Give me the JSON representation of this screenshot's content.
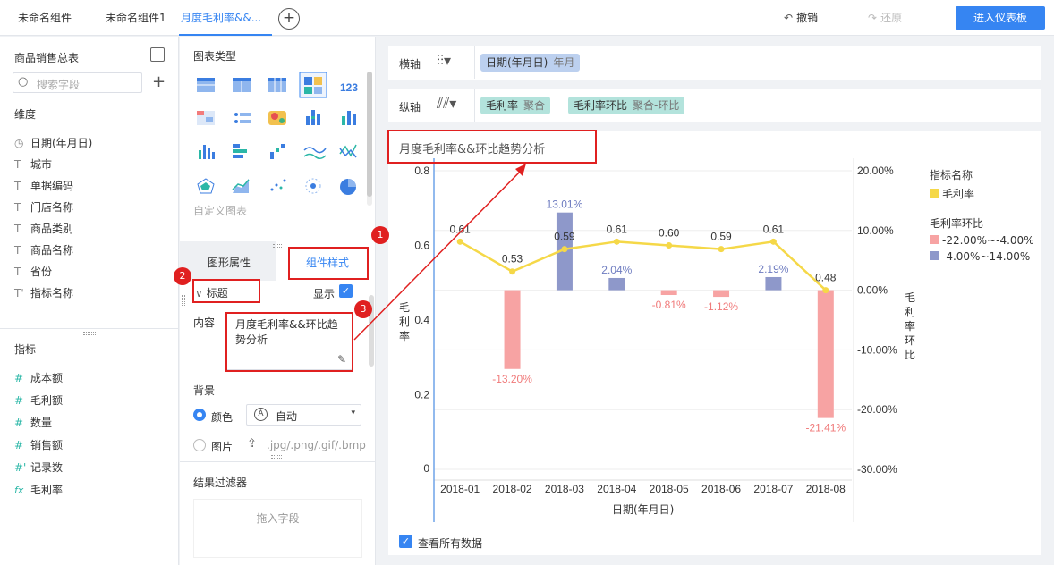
{
  "tabs": [
    {
      "label": "未命名组件"
    },
    {
      "label": "未命名组件1"
    },
    {
      "label": "月度毛利率&&..."
    }
  ],
  "toolbar": {
    "undo": "撤销",
    "redo": "还原",
    "enter_dashboard": "进入仪表板"
  },
  "left": {
    "table_title": "商品销售总表",
    "search_placeholder": "搜索字段",
    "dimensions_title": "维度",
    "dimensions": [
      "日期(年月日)",
      "城市",
      "单据编码",
      "门店名称",
      "商品类别",
      "商品名称",
      "省份",
      "指标名称"
    ],
    "metrics_title": "指标",
    "metrics": [
      "成本额",
      "毛利额",
      "数量",
      "销售额",
      "记录数",
      "毛利率"
    ]
  },
  "middle": {
    "chart_type_title": "图表类型",
    "custom_chart": "自定义图表",
    "tab_shape": "图形属性",
    "tab_style": "组件样式",
    "title_section": "标题",
    "show_label": "显示",
    "content_label": "内容",
    "content_text": "月度毛利率&&环比趋势分析",
    "background_label": "背景",
    "color_option": "颜色",
    "auto_option": "自动",
    "image_option": "图片",
    "image_formats": ".jpg/.png/.gif/.bmp",
    "filter_title": "结果过滤器",
    "drop_field": "拖入字段"
  },
  "axes": {
    "x_label": "横轴",
    "y_label": "纵轴",
    "x_pill": {
      "name": "日期(年月日)",
      "sub": "年月"
    },
    "y_pills": [
      {
        "name": "毛利率",
        "sub": "聚合"
      },
      {
        "name": "毛利率环比",
        "sub": "聚合-环比"
      }
    ]
  },
  "chart_data": {
    "type": "bar",
    "title": "月度毛利率&&环比趋势分析",
    "categories": [
      "2018-01",
      "2018-02",
      "2018-03",
      "2018-04",
      "2018-05",
      "2018-06",
      "2018-07",
      "2018-08"
    ],
    "line": {
      "name": "毛利率",
      "values": [
        0.61,
        0.53,
        0.59,
        0.61,
        0.6,
        0.59,
        0.61,
        0.48
      ],
      "labels": [
        "0.61",
        "0.53",
        "0.59",
        "0.61",
        "0.60",
        "0.59",
        "0.61",
        "0.48"
      ]
    },
    "bars": {
      "name": "毛利率环比",
      "values": [
        null,
        -13.2,
        13.01,
        2.04,
        -0.81,
        -1.12,
        2.19,
        -21.41
      ],
      "labels": [
        "",
        "-13.20%",
        "13.01%",
        "2.04%",
        "-0.81%",
        "-1.12%",
        "2.19%",
        "-21.41%"
      ]
    },
    "left_ticks": [
      "0.8",
      "0.6",
      "0.4",
      "0.2",
      "0"
    ],
    "left_ylim": [
      0,
      0.8
    ],
    "right_ticks": [
      "20.00%",
      "10.00%",
      "0.00%",
      "-10.00%",
      "-20.00%",
      "-30.00%"
    ],
    "right_ylim": [
      -30,
      20
    ],
    "left_axis_label": "毛利率",
    "right_axis_label": "毛利率环比",
    "xlabel": "日期(年月日)",
    "colors": {
      "line": "#f5d848",
      "positive": "#8e98ca",
      "negative": "#f7a3a3",
      "pos_label": "#6e7cc0",
      "neg_label": "#f07a7a"
    },
    "legend": {
      "title1": "指标名称",
      "item1": "毛利率",
      "title2": "毛利率环比",
      "item2": "-22.00%~-4.00%",
      "item3": "-4.00%~14.00%",
      "placement": "right"
    }
  },
  "footer": {
    "view_all": "查看所有数据"
  },
  "annotations": {
    "badge1": "1",
    "badge2": "2",
    "badge3": "3"
  }
}
